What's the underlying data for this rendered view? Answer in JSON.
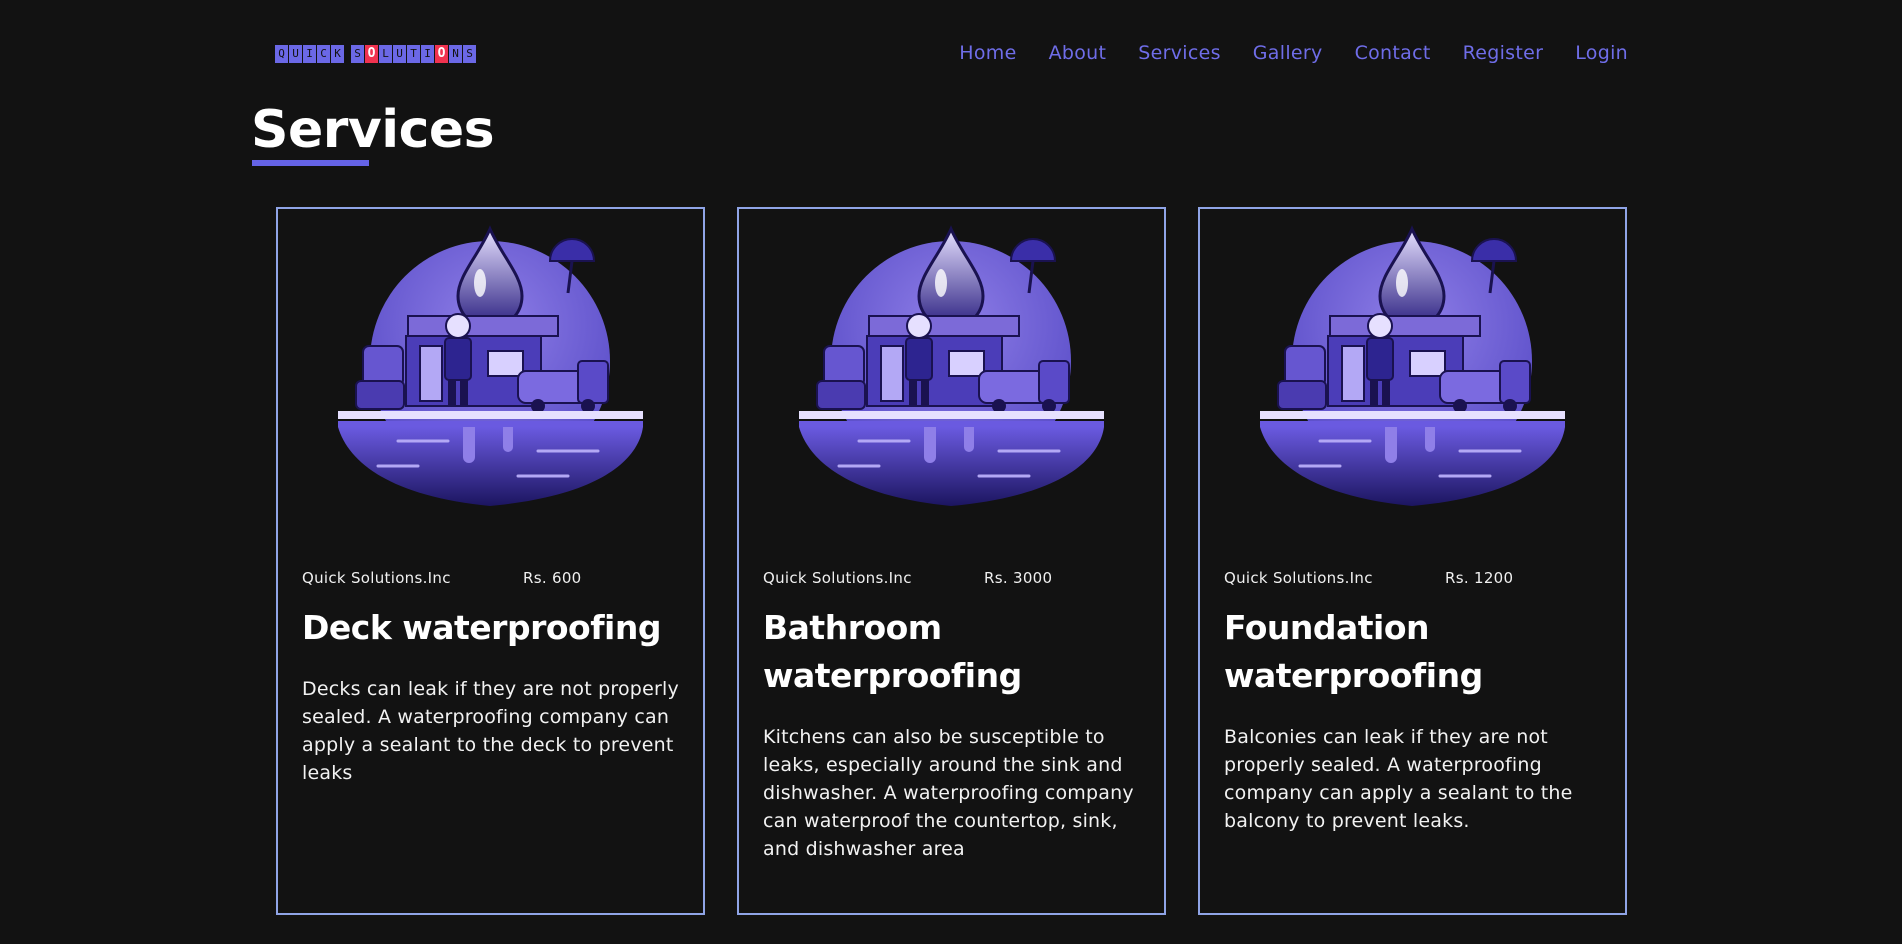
{
  "brand": {
    "logo_text": [
      "Q",
      "U",
      "I",
      "C",
      "K",
      " ",
      "S",
      "O",
      "L",
      "U",
      "T",
      "I",
      "O",
      "N",
      "S"
    ],
    "logo_highlight_indices": [
      7,
      12
    ],
    "accent_color": "#6b68e6",
    "highlight_color": "#f0324f"
  },
  "nav": {
    "items": [
      "Home",
      "About",
      "Services",
      "Gallery",
      "Contact",
      "Register",
      "Login"
    ]
  },
  "page": {
    "title": "Services"
  },
  "cards": [
    {
      "image_icon": "waterproofing-worker-illustration",
      "company": "Quick Solutions.Inc",
      "price": "Rs. 600",
      "title": "Deck waterproofing",
      "description": "Decks can leak if they are not properly sealed. A waterproofing company can apply a sealant to the deck to prevent leaks"
    },
    {
      "image_icon": "waterproofing-worker-illustration",
      "company": "Quick Solutions.Inc",
      "price": "Rs. 3000",
      "title": "Bathroom waterproofing",
      "description": "Kitchens can also be susceptible to leaks, especially around the sink and dishwasher. A waterproofing company can waterproof the countertop, sink, and dishwasher area"
    },
    {
      "image_icon": "waterproofing-worker-illustration",
      "company": "Quick Solutions.Inc",
      "price": "Rs. 1200",
      "title": "Foundation waterproofing",
      "description": "Balconies can leak if they are not properly sealed. A waterproofing company can apply a sealant to the balcony to prevent leaks."
    }
  ]
}
